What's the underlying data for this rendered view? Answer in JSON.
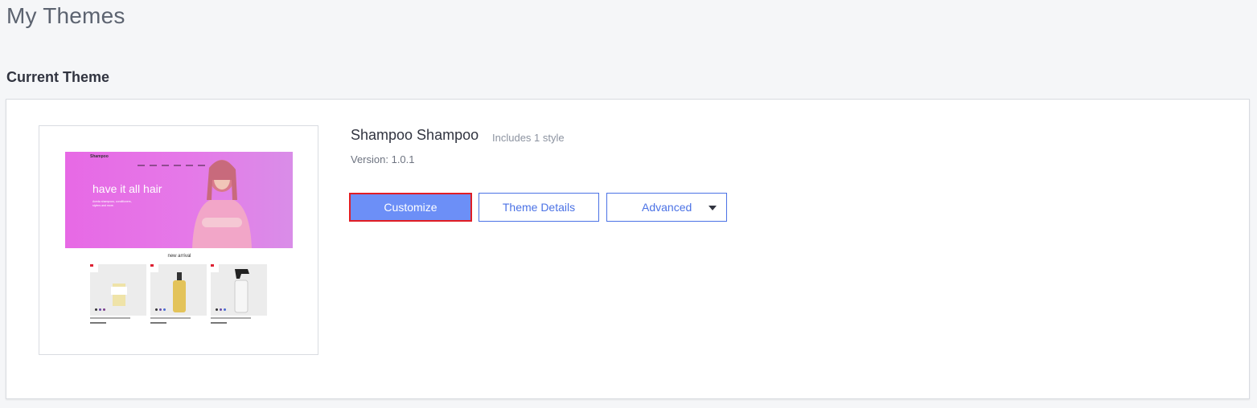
{
  "page": {
    "title": "My Themes"
  },
  "section": {
    "title": "Current Theme"
  },
  "theme": {
    "name": "Shampoo Shampoo",
    "styles_note": "Includes 1 style",
    "version": "Version: 1.0.1"
  },
  "preview": {
    "logo": "Shampoo",
    "headline": "have it all hair",
    "subtext": "Aveda shampoos, conditioners, stylers and more.",
    "section_heading": "new arrival"
  },
  "actions": {
    "customize_label": "Customize",
    "details_label": "Theme Details",
    "advanced_label": "Advanced"
  },
  "colors": {
    "primary": "#6c8ff7",
    "highlight_border": "#e11d24",
    "outline": "#4b72e5",
    "hero_pink": "#e769e5"
  }
}
